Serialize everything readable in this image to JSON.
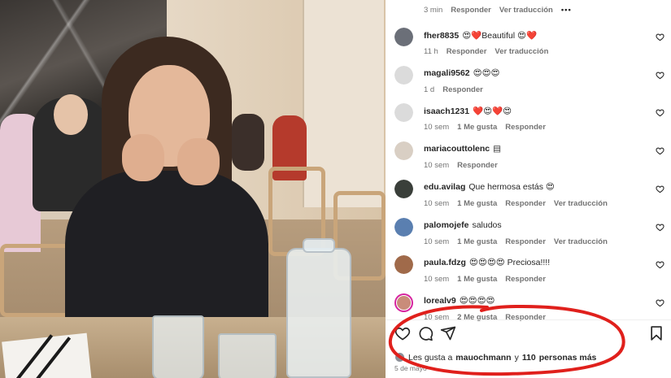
{
  "photo": {
    "alt_subject": "photo",
    "bottle_label": ""
  },
  "top_comment_meta": {
    "time": "3 min",
    "reply": "Responder",
    "translate": "Ver traducción",
    "more_icon": "more-icon"
  },
  "comments": [
    {
      "user": "fher8835",
      "text": "😍❤️Beautiful 😍❤️",
      "time": "11 h",
      "likes": "",
      "reply": "Responder",
      "translate": "Ver traducción",
      "avatar_color": "#6b6f78",
      "story": false
    },
    {
      "user": "magali9562",
      "text": "😍😍😍",
      "time": "1 d",
      "likes": "",
      "reply": "Responder",
      "translate": "",
      "avatar_color": "#dbdbdb",
      "story": false
    },
    {
      "user": "isaach1231",
      "text": "❤️😍❤️😍",
      "time": "10 sem",
      "likes": "1 Me gusta",
      "reply": "Responder",
      "translate": "",
      "avatar_color": "#dbdbdb",
      "story": false
    },
    {
      "user": "mariacouttolenc",
      "text": "▤",
      "time": "10 sem",
      "likes": "",
      "reply": "Responder",
      "translate": "",
      "avatar_color": "#d9cfc4",
      "story": false
    },
    {
      "user": "edu.avilag",
      "text": "Que hermosa estás 😍",
      "time": "10 sem",
      "likes": "1 Me gusta",
      "reply": "Responder",
      "translate": "Ver traducción",
      "avatar_color": "#3a3f3a",
      "story": false
    },
    {
      "user": "palomojefe",
      "text": "saludos",
      "time": "10 sem",
      "likes": "1 Me gusta",
      "reply": "Responder",
      "translate": "Ver traducción",
      "avatar_color": "#5a7fb0",
      "story": false
    },
    {
      "user": "paula.fdzg",
      "text": "😍😍😍😍 Preciosa!!!!",
      "time": "10 sem",
      "likes": "1 Me gusta",
      "reply": "Responder",
      "translate": "",
      "avatar_color": "#a06a4a",
      "story": false
    },
    {
      "user": "lorealv9",
      "text": "😍😍😍😍",
      "time": "10 sem",
      "likes": "2 Me gusta",
      "reply": "Responder",
      "translate": "",
      "avatar_color": "#c98c7a",
      "story": true
    }
  ],
  "actions": {
    "like_icon": "heart-icon",
    "comment_icon": "comment-icon",
    "share_icon": "send-icon",
    "save_icon": "bookmark-icon"
  },
  "likes": {
    "prefix": "Les gusta a",
    "user": "mauochmann",
    "connector": "y",
    "count": "110",
    "suffix": "personas más"
  },
  "date": "5 de mayo",
  "colors": {
    "annotation": "#e0201c",
    "meta_text": "#737373",
    "story_ring": "#d6249f"
  }
}
